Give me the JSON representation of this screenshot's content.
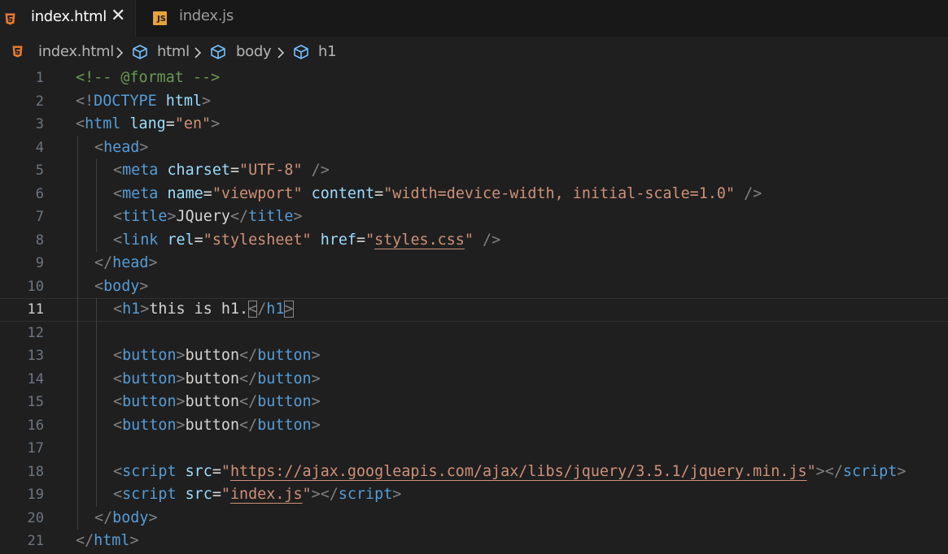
{
  "tabs": [
    {
      "label": "index.html",
      "icon": "html5-icon",
      "active": true,
      "close_glyph": "✕"
    },
    {
      "label": "index.js",
      "icon": "js-icon",
      "active": false,
      "icon_text": "JS"
    }
  ],
  "breadcrumb": [
    "index.html",
    "html",
    "body",
    "h1"
  ],
  "colors": {
    "html5": "#e37933",
    "js": "#e8a33a",
    "cube": "#75beff",
    "tag": "#569cd6",
    "attr": "#9cdcfe",
    "string": "#ce9178",
    "comment": "#6a9955",
    "text": "#d4d4d4"
  },
  "editor": {
    "active_line": 11,
    "lines": [
      {
        "n": "1",
        "indent": 0,
        "tokens": [
          [
            "t-comment",
            "<!-- @format -->"
          ]
        ]
      },
      {
        "n": "2",
        "indent": 0,
        "tokens": [
          [
            "t-punct",
            "<!"
          ],
          [
            "t-doc",
            "DOCTYPE"
          ],
          [
            "t-text",
            " "
          ],
          [
            "t-attr",
            "html"
          ],
          [
            "t-punct",
            ">"
          ]
        ]
      },
      {
        "n": "3",
        "indent": 0,
        "tokens": [
          [
            "t-punct",
            "<"
          ],
          [
            "t-tag",
            "html"
          ],
          [
            "t-text",
            " "
          ],
          [
            "t-attr",
            "lang"
          ],
          [
            "t-text",
            "="
          ],
          [
            "t-str",
            "\"en\""
          ],
          [
            "t-punct",
            ">"
          ]
        ]
      },
      {
        "n": "4",
        "indent": 1,
        "tokens": [
          [
            "t-punct",
            "<"
          ],
          [
            "t-tag",
            "head"
          ],
          [
            "t-punct",
            ">"
          ]
        ]
      },
      {
        "n": "5",
        "indent": 2,
        "tokens": [
          [
            "t-punct",
            "<"
          ],
          [
            "t-tag",
            "meta"
          ],
          [
            "t-text",
            " "
          ],
          [
            "t-attr",
            "charset"
          ],
          [
            "t-text",
            "="
          ],
          [
            "t-str",
            "\"UTF-8\""
          ],
          [
            "t-text",
            " "
          ],
          [
            "t-punct",
            "/>"
          ]
        ]
      },
      {
        "n": "6",
        "indent": 2,
        "tokens": [
          [
            "t-punct",
            "<"
          ],
          [
            "t-tag",
            "meta"
          ],
          [
            "t-text",
            " "
          ],
          [
            "t-attr",
            "name"
          ],
          [
            "t-text",
            "="
          ],
          [
            "t-str",
            "\"viewport\""
          ],
          [
            "t-text",
            " "
          ],
          [
            "t-attr",
            "content"
          ],
          [
            "t-text",
            "="
          ],
          [
            "t-str",
            "\"width=device-width, initial-scale=1.0\""
          ],
          [
            "t-text",
            " "
          ],
          [
            "t-punct",
            "/>"
          ]
        ]
      },
      {
        "n": "7",
        "indent": 2,
        "tokens": [
          [
            "t-punct",
            "<"
          ],
          [
            "t-tag",
            "title"
          ],
          [
            "t-punct",
            ">"
          ],
          [
            "t-text",
            "JQuery"
          ],
          [
            "t-punct",
            "</"
          ],
          [
            "t-tag",
            "title"
          ],
          [
            "t-punct",
            ">"
          ]
        ]
      },
      {
        "n": "8",
        "indent": 2,
        "tokens": [
          [
            "t-punct",
            "<"
          ],
          [
            "t-tag",
            "link"
          ],
          [
            "t-text",
            " "
          ],
          [
            "t-attr",
            "rel"
          ],
          [
            "t-text",
            "="
          ],
          [
            "t-str",
            "\"stylesheet\""
          ],
          [
            "t-text",
            " "
          ],
          [
            "t-attr",
            "href"
          ],
          [
            "t-text",
            "="
          ],
          [
            "t-str",
            "\""
          ],
          [
            "t-str link-u",
            "styles.css"
          ],
          [
            "t-str",
            "\""
          ],
          [
            "t-text",
            " "
          ],
          [
            "t-punct",
            "/>"
          ]
        ]
      },
      {
        "n": "9",
        "indent": 1,
        "tokens": [
          [
            "t-punct",
            "</"
          ],
          [
            "t-tag",
            "head"
          ],
          [
            "t-punct",
            ">"
          ]
        ]
      },
      {
        "n": "10",
        "indent": 1,
        "tokens": [
          [
            "t-punct",
            "<"
          ],
          [
            "t-tag",
            "body"
          ],
          [
            "t-punct",
            ">"
          ]
        ]
      },
      {
        "n": "11",
        "indent": 2,
        "tokens": [
          [
            "t-punct",
            "<"
          ],
          [
            "t-tag",
            "h1"
          ],
          [
            "t-punct",
            ">"
          ],
          [
            "t-text",
            "this is h1."
          ],
          [
            "t-punct bracket-box",
            "<"
          ],
          [
            "t-punct",
            "/"
          ],
          [
            "t-tag",
            "h1"
          ],
          [
            "t-punct bracket-box",
            ">"
          ]
        ]
      },
      {
        "n": "12",
        "indent": 2,
        "tokens": []
      },
      {
        "n": "13",
        "indent": 2,
        "tokens": [
          [
            "t-punct",
            "<"
          ],
          [
            "t-tag",
            "button"
          ],
          [
            "t-punct",
            ">"
          ],
          [
            "t-text",
            "button"
          ],
          [
            "t-punct",
            "</"
          ],
          [
            "t-tag",
            "button"
          ],
          [
            "t-punct",
            ">"
          ]
        ]
      },
      {
        "n": "14",
        "indent": 2,
        "tokens": [
          [
            "t-punct",
            "<"
          ],
          [
            "t-tag",
            "button"
          ],
          [
            "t-punct",
            ">"
          ],
          [
            "t-text",
            "button"
          ],
          [
            "t-punct",
            "</"
          ],
          [
            "t-tag",
            "button"
          ],
          [
            "t-punct",
            ">"
          ]
        ]
      },
      {
        "n": "15",
        "indent": 2,
        "tokens": [
          [
            "t-punct",
            "<"
          ],
          [
            "t-tag",
            "button"
          ],
          [
            "t-punct",
            ">"
          ],
          [
            "t-text",
            "button"
          ],
          [
            "t-punct",
            "</"
          ],
          [
            "t-tag",
            "button"
          ],
          [
            "t-punct",
            ">"
          ]
        ]
      },
      {
        "n": "16",
        "indent": 2,
        "tokens": [
          [
            "t-punct",
            "<"
          ],
          [
            "t-tag",
            "button"
          ],
          [
            "t-punct",
            ">"
          ],
          [
            "t-text",
            "button"
          ],
          [
            "t-punct",
            "</"
          ],
          [
            "t-tag",
            "button"
          ],
          [
            "t-punct",
            ">"
          ]
        ]
      },
      {
        "n": "17",
        "indent": 2,
        "tokens": []
      },
      {
        "n": "18",
        "indent": 2,
        "tokens": [
          [
            "t-punct",
            "<"
          ],
          [
            "t-tag",
            "script"
          ],
          [
            "t-text",
            " "
          ],
          [
            "t-attr",
            "src"
          ],
          [
            "t-text",
            "="
          ],
          [
            "t-str",
            "\""
          ],
          [
            "t-str link-u",
            "https://ajax.googleapis.com/ajax/libs/jquery/3.5.1/jquery.min.js"
          ],
          [
            "t-str",
            "\""
          ],
          [
            "t-punct",
            "></"
          ],
          [
            "t-tag",
            "script"
          ],
          [
            "t-punct",
            ">"
          ]
        ]
      },
      {
        "n": "19",
        "indent": 2,
        "tokens": [
          [
            "t-punct",
            "<"
          ],
          [
            "t-tag",
            "script"
          ],
          [
            "t-text",
            " "
          ],
          [
            "t-attr",
            "src"
          ],
          [
            "t-text",
            "="
          ],
          [
            "t-str",
            "\""
          ],
          [
            "t-str link-u",
            "index.js"
          ],
          [
            "t-str",
            "\""
          ],
          [
            "t-punct",
            "></"
          ],
          [
            "t-tag",
            "script"
          ],
          [
            "t-punct",
            ">"
          ]
        ]
      },
      {
        "n": "20",
        "indent": 1,
        "tokens": [
          [
            "t-punct",
            "</"
          ],
          [
            "t-tag",
            "body"
          ],
          [
            "t-punct",
            ">"
          ]
        ]
      },
      {
        "n": "21",
        "indent": 0,
        "tokens": [
          [
            "t-punct",
            "</"
          ],
          [
            "t-tag",
            "html"
          ],
          [
            "t-punct",
            ">"
          ]
        ]
      }
    ]
  }
}
